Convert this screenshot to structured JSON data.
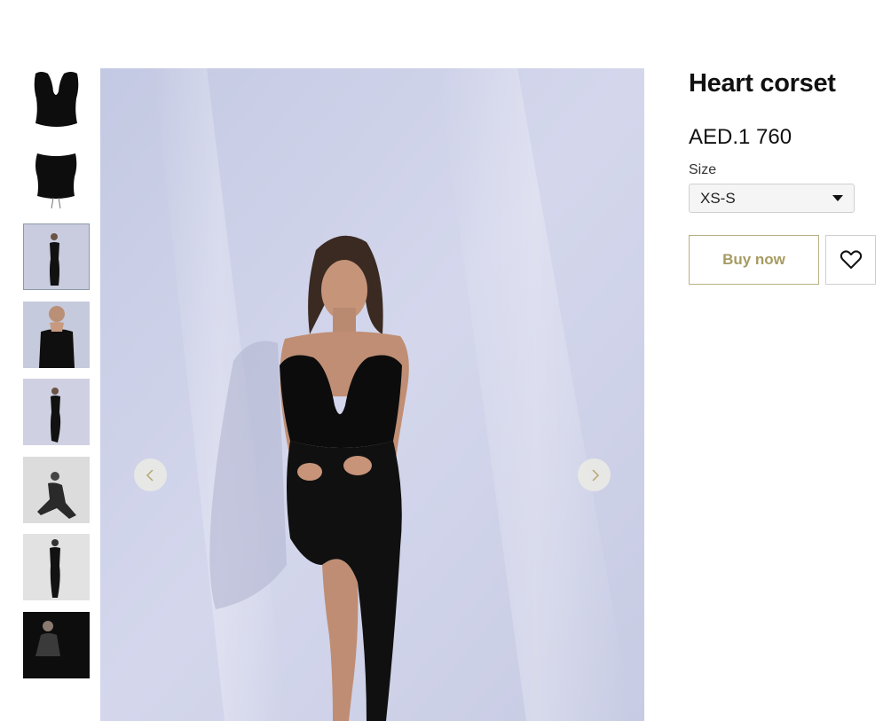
{
  "product": {
    "title": "Heart corset",
    "price": "AED.1 760",
    "size_label": "Size",
    "size_selected": "XS-S",
    "buy_label": "Buy now"
  },
  "gallery": {
    "thumbnails": [
      "corset-front-image",
      "corset-back-image",
      "model-standing-image",
      "model-closeup-image",
      "model-leaning-image",
      "model-seated-bw-image",
      "model-bw-pose-image",
      "model-dark-image"
    ],
    "active_index": 2
  },
  "icons": {
    "prev": "chevron-left-icon",
    "next": "chevron-right-icon",
    "wishlist": "heart-icon",
    "dropdown": "caret-down-icon"
  },
  "colors": {
    "accent": "#a69b62",
    "accent_border": "#b8b083"
  }
}
